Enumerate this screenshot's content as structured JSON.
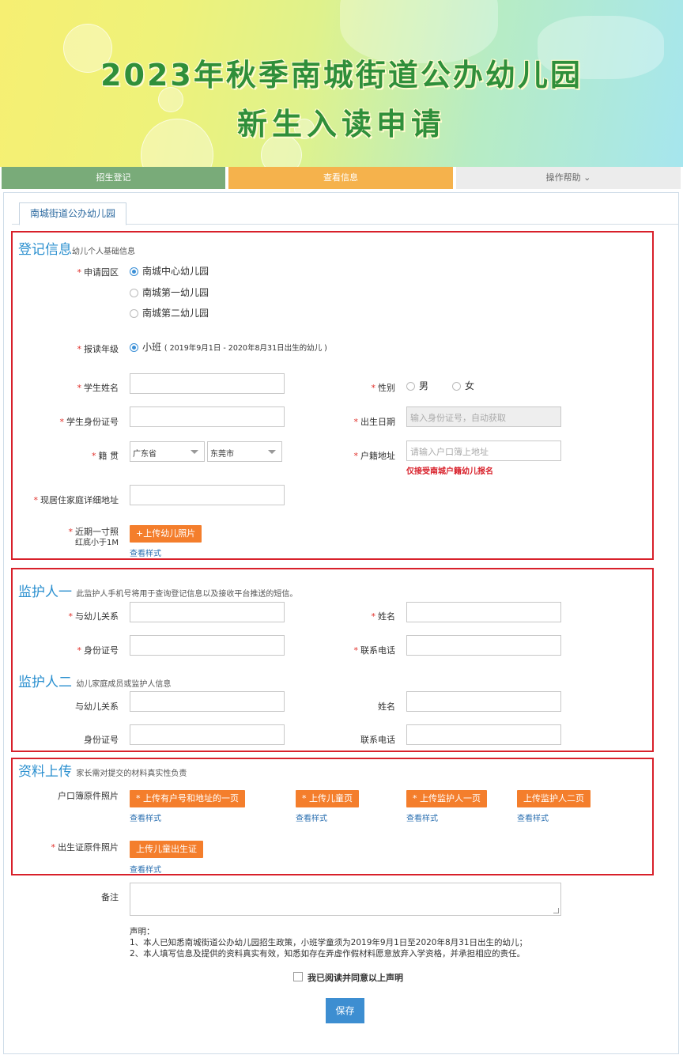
{
  "banner": {
    "title_line1": "2023年秋季南城街道公办幼儿园",
    "title_line2": "新生入读申请"
  },
  "nav": {
    "item1": "招生登记",
    "item2": "查看信息",
    "item3": "操作帮助 ⌄"
  },
  "tab": {
    "label": "南城街道公办幼儿园"
  },
  "reg": {
    "title": "登记信息",
    "subtitle": "幼儿个人基础信息",
    "campus_label": "申请园区",
    "campus_options": [
      "南城中心幼儿园",
      "南城第一幼儿园",
      "南城第二幼儿园"
    ],
    "grade_label": "报读年级",
    "grade_option": "小班",
    "grade_note": "( 2019年9月1日 - 2020年8月31日出生的幼儿 )",
    "name_label": "学生姓名",
    "gender_label": "性别",
    "gender_male": "男",
    "gender_female": "女",
    "id_label": "学生身份证号",
    "birth_label": "出生日期",
    "birth_placeholder": "输入身份证号，自动获取",
    "native_label": "籍 贯",
    "province": "广东省",
    "city": "东莞市",
    "hukou_label": "户籍地址",
    "hukou_placeholder": "请输入户口簿上地址",
    "hukou_hint": "仅接受南城户籍幼儿报名",
    "address_label": "现居住家庭详细地址",
    "photo_label": "近期一寸照",
    "photo_sub": "红底小于1M",
    "photo_button": "+上传幼儿照片",
    "photo_link": "查看样式"
  },
  "guardian1": {
    "title": "监护人一",
    "subtitle": "此监护人手机号将用于查询登记信息以及接收平台推送的短信。",
    "relation_label": "与幼儿关系",
    "name_label": "姓名",
    "id_label": "身份证号",
    "phone_label": "联系电话"
  },
  "guardian2": {
    "title": "监护人二",
    "subtitle": "幼儿家庭成员或监护人信息",
    "relation_label": "与幼儿关系",
    "name_label": "姓名",
    "id_label": "身份证号",
    "phone_label": "联系电话"
  },
  "upload": {
    "title": "资料上传",
    "subtitle": "家长需对提交的材料真实性负责",
    "hukou_label": "户口簿原件照片",
    "btn1": "* 上传有户号和地址的一页",
    "btn2": "* 上传儿童页",
    "btn3": "* 上传监护人一页",
    "btn4": "上传监护人二页",
    "link": "查看样式",
    "birth_label": "出生证原件照片",
    "birth_btn": "上传儿童出生证",
    "birth_link": "查看样式"
  },
  "remark": {
    "label": "备注"
  },
  "declaration": {
    "title": "声明：",
    "line1": "1、本人已知悉南城街道公办幼儿园招生政策，小班学童须为2019年9月1日至2020年8月31日出生的幼儿；",
    "line2": "2、本人填写信息及提供的资料真实有效，知悉如存在弄虚作假材料愿意放弃入学资格，并承担相应的责任。",
    "agree": "我已阅读并同意以上声明"
  },
  "save": {
    "label": "保存"
  },
  "required_mark": "*"
}
